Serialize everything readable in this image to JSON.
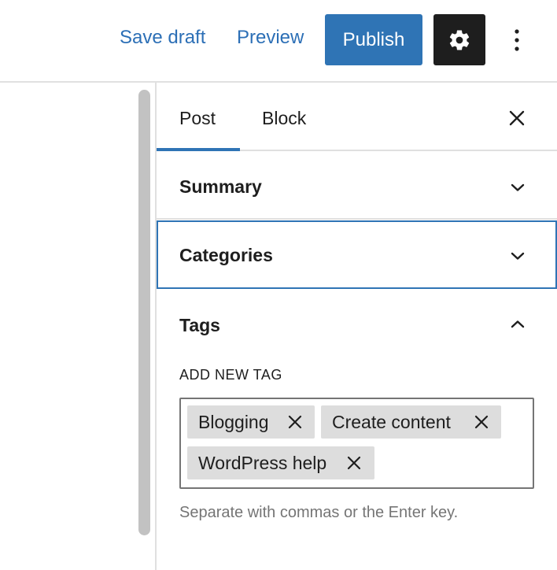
{
  "header": {
    "save_draft": "Save draft",
    "preview": "Preview",
    "publish": "Publish",
    "settings_icon": "gear-icon",
    "more_icon": "vertical-ellipsis-icon"
  },
  "sidebar": {
    "tabs": [
      {
        "label": "Post",
        "active": true
      },
      {
        "label": "Block",
        "active": false
      }
    ],
    "close_icon": "close-icon",
    "panels": {
      "summary": {
        "title": "Summary",
        "expanded": false
      },
      "categories": {
        "title": "Categories",
        "expanded": false,
        "focused": true
      },
      "tags": {
        "title": "Tags",
        "expanded": true,
        "field_label": "ADD NEW TAG",
        "tags": [
          "Blogging",
          "Create content",
          "WordPress help"
        ],
        "help_text": "Separate with commas or the Enter key."
      }
    }
  },
  "colors": {
    "accent": "#2f74b5",
    "link": "#2c6fb6",
    "dark": "#1e1e1e",
    "chip_bg": "#dddddd",
    "muted": "#757575"
  }
}
